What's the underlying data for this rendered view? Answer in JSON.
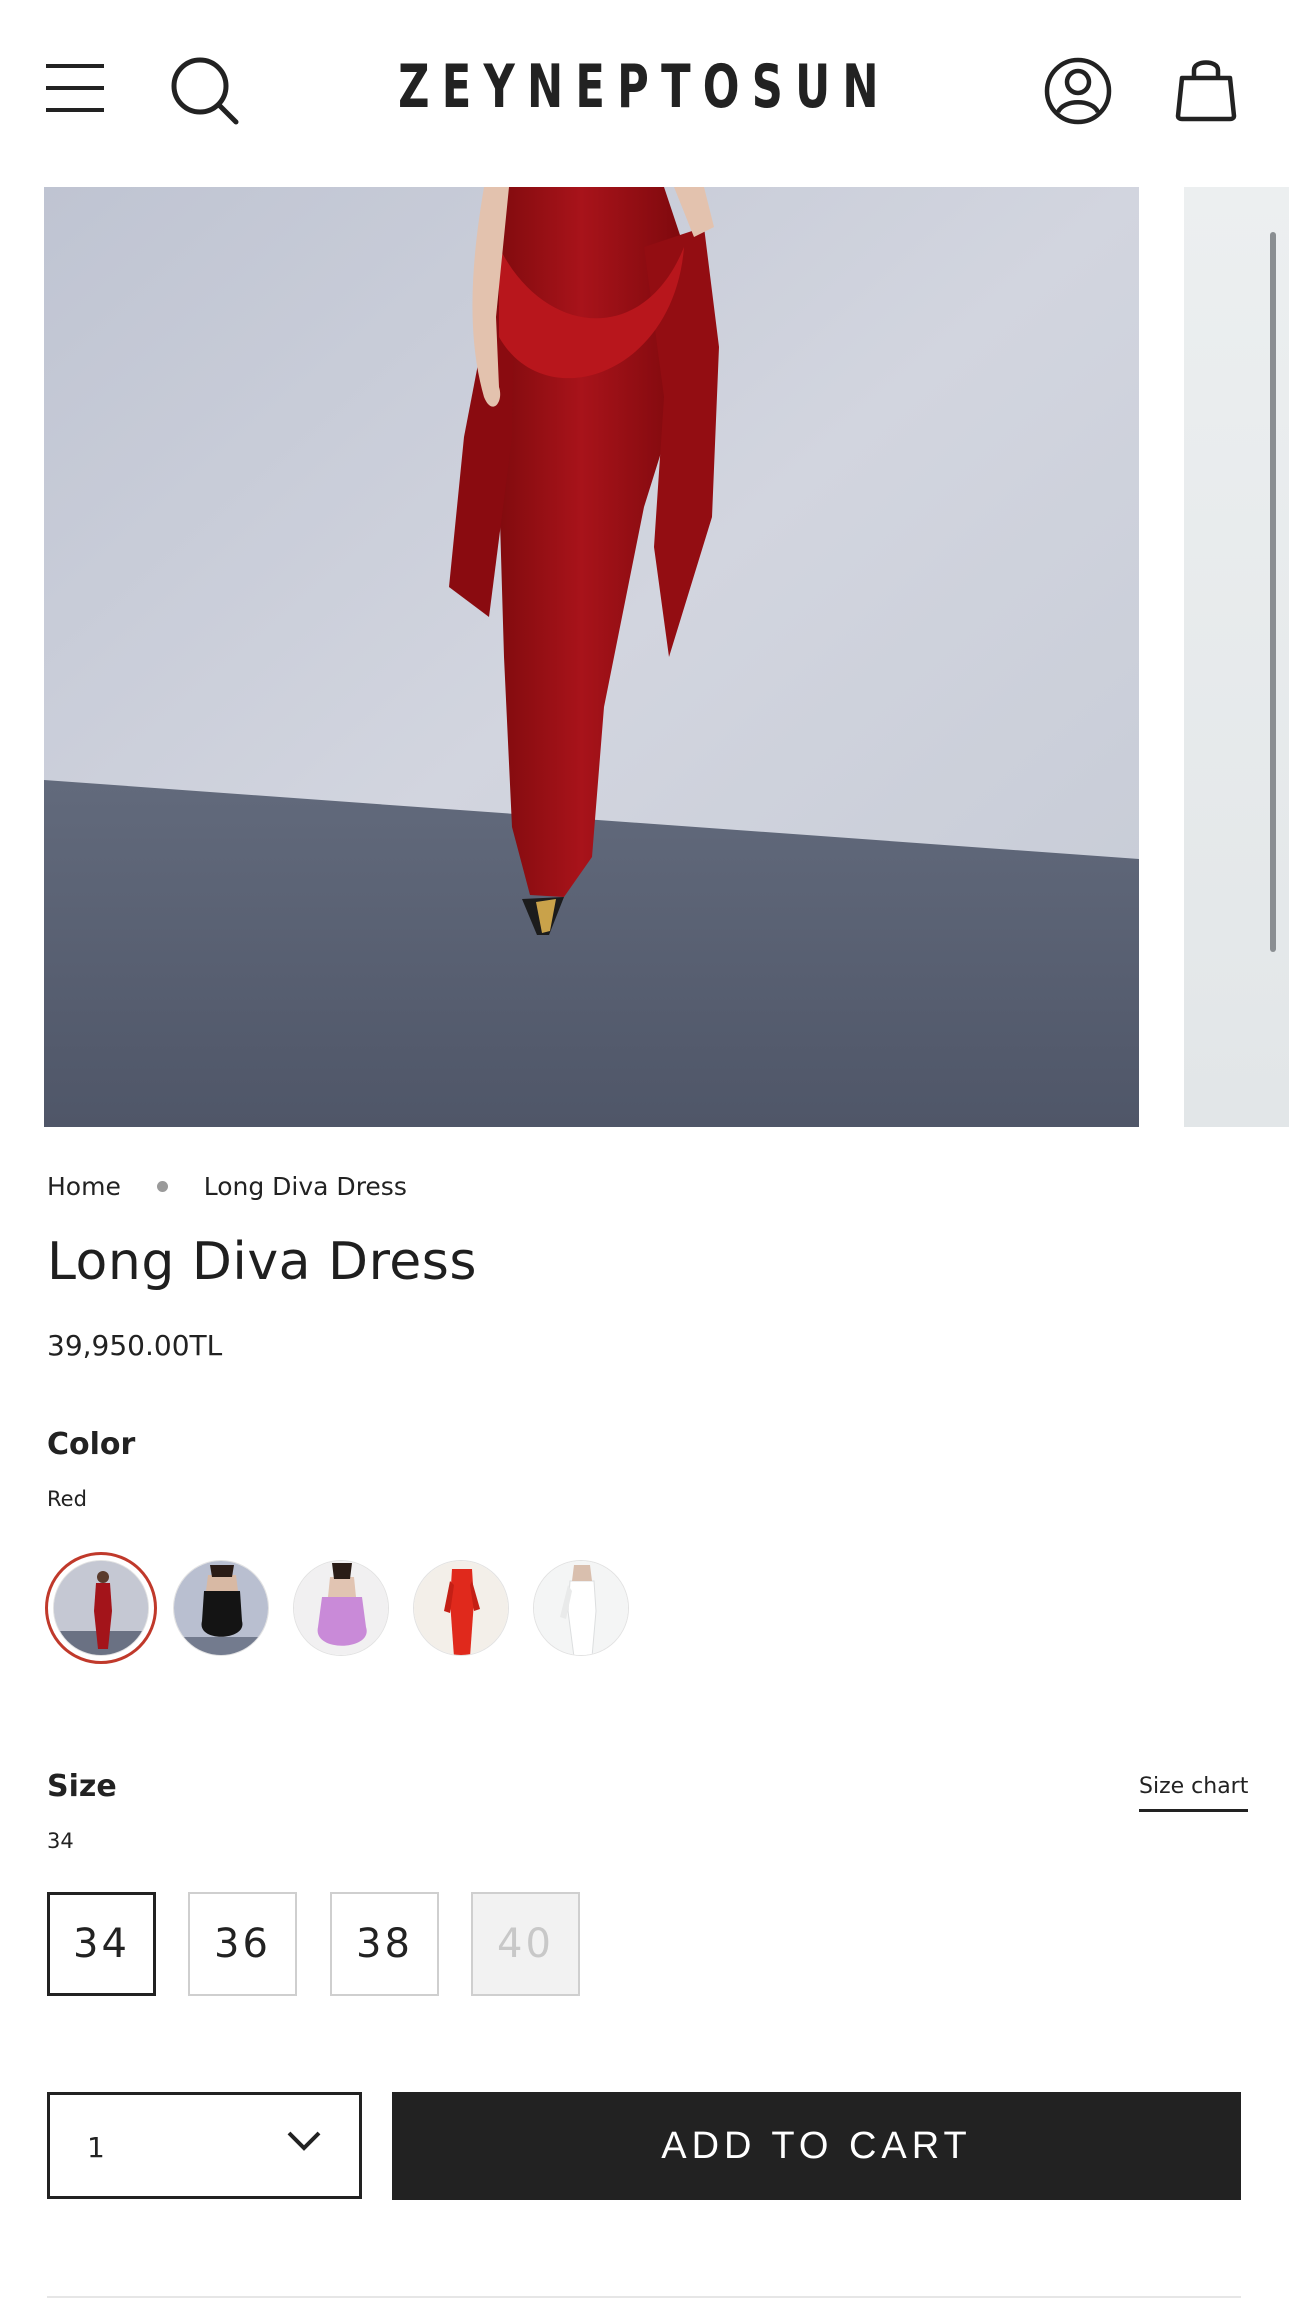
{
  "header": {
    "brand": "ZEYNEPTOSUN",
    "icons": [
      "menu-icon",
      "search-icon",
      "account-icon",
      "bag-icon"
    ]
  },
  "breadcrumb": {
    "home": "Home",
    "current": "Long Diva Dress"
  },
  "product": {
    "title": "Long Diva Dress",
    "price": "39,950.00TL"
  },
  "color_option": {
    "label": "Color",
    "selected_value": "Red",
    "swatches": [
      "Red",
      "Black",
      "Lilac",
      "Orange-red",
      "White"
    ]
  },
  "size_option": {
    "label": "Size",
    "selected_value": "34",
    "size_chart_label": "Size chart",
    "sizes": [
      {
        "label": "34",
        "state": "selected"
      },
      {
        "label": "36",
        "state": "available"
      },
      {
        "label": "38",
        "state": "available"
      },
      {
        "label": "40",
        "state": "unavailable"
      }
    ]
  },
  "purchase": {
    "quantity": "1",
    "add_to_cart_label": "ADD TO CART"
  },
  "colors": {
    "text": "#222222",
    "button_bg": "#222222",
    "selected_ring": "#c0392b",
    "dress_red": "#9e0f12"
  }
}
